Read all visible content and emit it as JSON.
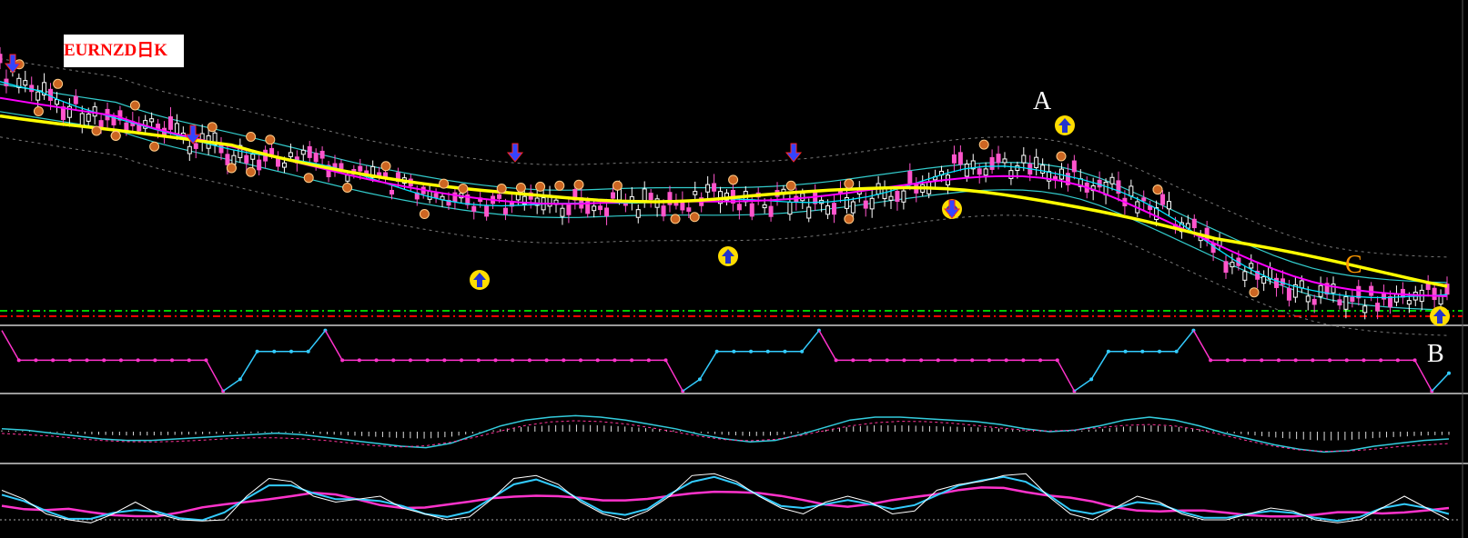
{
  "title": "EURNZD日K",
  "annotations": [
    {
      "id": "A",
      "text": "A",
      "color": "#ffffff"
    },
    {
      "id": "B",
      "text": "B",
      "color": "#ffffff"
    },
    {
      "id": "C",
      "text": "C",
      "color": "#ff9900"
    }
  ],
  "colors": {
    "background": "#000000",
    "ma_long": "#ffff00",
    "ma_mid": "#ff00ff",
    "ma_short": "#00e5ff",
    "candle_up": "#ffffff",
    "candle_down": "#ff55cc",
    "envelope": "#33cccc",
    "support_green": "#00cc00",
    "support_red": "#ff0000",
    "stoch_main": "#ffffff",
    "panel_border": "#888888"
  },
  "chart_data": [
    {
      "type": "line",
      "panel": "price",
      "series": [
        {
          "values": [
            95,
            108,
            120,
            128,
            134,
            140,
            145,
            150,
            156,
            162,
            168,
            172,
            178,
            182,
            185,
            187,
            188,
            192,
            198,
            205,
            212,
            218,
            225,
            230,
            235,
            236,
            235,
            234,
            233,
            232,
            231,
            231,
            232,
            233,
            232,
            230,
            228,
            226,
            226,
            228,
            230,
            232,
            232,
            232,
            230,
            226,
            222,
            216,
            208,
            200,
            194,
            190,
            192,
            196,
            198,
            202,
            206,
            212,
            218,
            226,
            236,
            248,
            262,
            278,
            294,
            305,
            312,
            318,
            322,
            325,
            328,
            330,
            330,
            328,
            326,
            322
          ]
        }
      ],
      "markers": {
        "buy_arrows": 5,
        "sell_arrows": 5
      }
    },
    {
      "type": "line",
      "panel": "oscillator_1",
      "series": [
        {
          "values": [
            98,
            2,
            2,
            2,
            2,
            2,
            2,
            2,
            2,
            2,
            2,
            2,
            2,
            -98,
            -60,
            30,
            30,
            30,
            30,
            98,
            2,
            2,
            2,
            2,
            2,
            2,
            2,
            2,
            2,
            2,
            2,
            2,
            2,
            2,
            2,
            2,
            2,
            2,
            2,
            2,
            -98,
            -60,
            30,
            30,
            30,
            30,
            30,
            30,
            98,
            2,
            2,
            2,
            2,
            2,
            2,
            2,
            2,
            2,
            2,
            2,
            2,
            2,
            2,
            -98,
            -60,
            30,
            30,
            30,
            30,
            30,
            98,
            2,
            2,
            2,
            2,
            2,
            2,
            2,
            2,
            2,
            2,
            2,
            2,
            2,
            -98,
            -40
          ]
        }
      ]
    },
    {
      "type": "line",
      "panel": "oscillator_2",
      "series": [
        {
          "values": [
            0.2,
            0.1,
            -0.1,
            -0.3,
            -0.5,
            -0.6,
            -0.6,
            -0.5,
            -0.4,
            -0.3,
            -0.2,
            -0.1,
            -0.2,
            -0.4,
            -0.6,
            -0.8,
            -1.0,
            -1.1,
            -0.8,
            -0.2,
            0.4,
            0.8,
            1.0,
            1.1,
            1.0,
            0.8,
            0.5,
            0.2,
            -0.2,
            -0.5,
            -0.7,
            -0.6,
            -0.2,
            0.3,
            0.8,
            1.0,
            1.0,
            0.9,
            0.8,
            0.7,
            0.5,
            0.2,
            0.0,
            0.1,
            0.4,
            0.8,
            1.0,
            0.8,
            0.4,
            -0.1,
            -0.5,
            -0.9,
            -1.2,
            -1.4,
            -1.3,
            -1.0,
            -0.8,
            -0.6,
            -0.5
          ]
        }
      ]
    },
    {
      "type": "line",
      "panel": "stochastic",
      "series": [
        {
          "values": [
            70,
            55,
            30,
            20,
            15,
            30,
            50,
            30,
            20,
            18,
            20,
            60,
            90,
            85,
            60,
            50,
            55,
            60,
            40,
            30,
            20,
            25,
            55,
            90,
            95,
            80,
            50,
            30,
            20,
            35,
            60,
            95,
            98,
            85,
            60,
            40,
            30,
            50,
            60,
            50,
            30,
            35,
            70,
            80,
            85,
            95,
            98,
            60,
            30,
            20,
            40,
            60,
            50,
            30,
            20,
            20,
            30,
            40,
            35,
            20,
            15,
            20,
            40,
            60,
            40,
            20
          ]
        }
      ]
    }
  ]
}
